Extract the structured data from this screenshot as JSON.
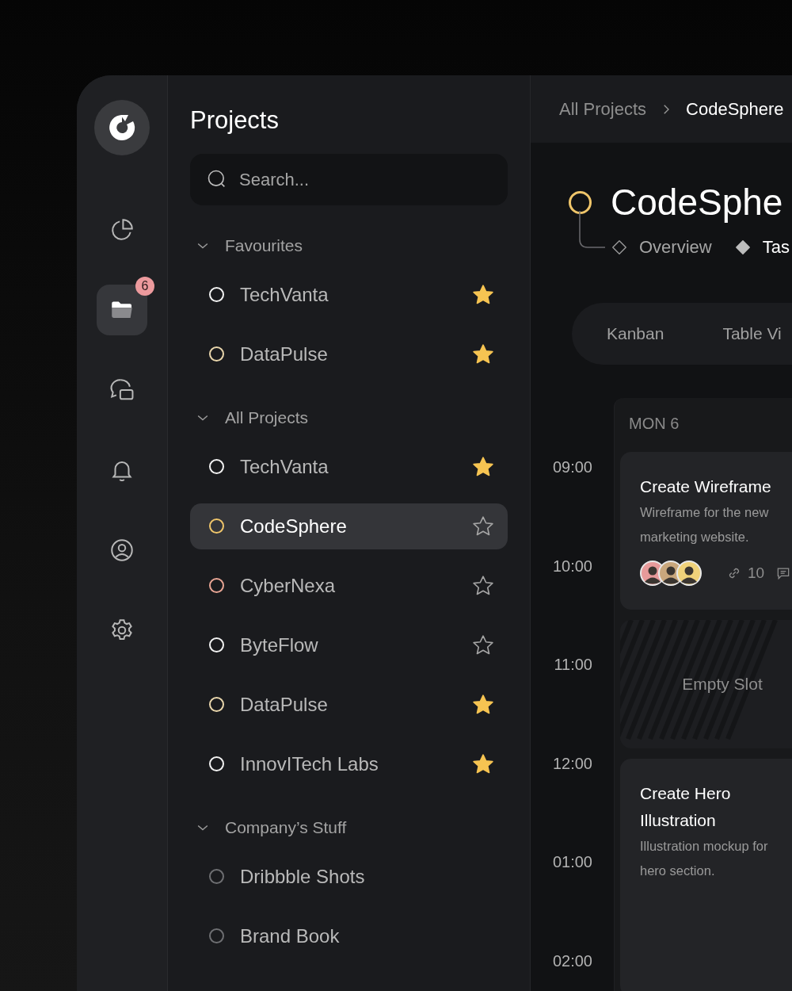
{
  "rail": {
    "items": [
      {
        "kind": "chart",
        "selected": false
      },
      {
        "kind": "folder",
        "selected": true,
        "badge": "6"
      },
      {
        "kind": "chat",
        "selected": false
      },
      {
        "kind": "bell",
        "selected": false
      },
      {
        "kind": "profile",
        "selected": false
      },
      {
        "kind": "settings",
        "selected": false
      }
    ]
  },
  "projects_panel": {
    "title": "Projects",
    "search": {
      "placeholder": "Search..."
    },
    "groups": [
      {
        "label": "Favourites",
        "expanded": true,
        "items": [
          {
            "name": "TechVanta",
            "color": "#f2f2f2",
            "starred": true,
            "selected": false
          },
          {
            "name": "DataPulse",
            "color": "#e9d6ac",
            "starred": true,
            "selected": false
          }
        ]
      },
      {
        "label": "All Projects",
        "expanded": true,
        "items": [
          {
            "name": "TechVanta",
            "color": "#f2f2f2",
            "starred": true,
            "selected": false
          },
          {
            "name": "CodeSphere",
            "color": "#efc56a",
            "starred": false,
            "selected": true
          },
          {
            "name": "CyberNexa",
            "color": "#e7a594",
            "starred": false,
            "selected": false
          },
          {
            "name": "ByteFlow",
            "color": "#f2f2f2",
            "starred": false,
            "selected": false
          },
          {
            "name": "DataPulse",
            "color": "#e9d6ac",
            "starred": true,
            "selected": false
          },
          {
            "name": "InnovITech Labs",
            "color": "#f2f2f2",
            "starred": true,
            "selected": false
          }
        ]
      },
      {
        "label": "Company’s Stuff",
        "expanded": true,
        "items": [
          {
            "name": "Dribbble Shots",
            "color": "#6e6f72",
            "selected": false
          },
          {
            "name": "Brand Book",
            "color": "#6e6f72",
            "selected": false
          }
        ]
      }
    ]
  },
  "breadcrumb": [
    {
      "label": "All Projects",
      "current": false
    },
    {
      "label": "CodeSphere",
      "current": true
    }
  ],
  "project": {
    "title": "CodeSphe",
    "color": "#efc56a",
    "tabs": [
      {
        "label": "Overview",
        "selected": false
      },
      {
        "label": "Tas",
        "selected": true
      }
    ],
    "views": [
      {
        "label": "Kanban"
      },
      {
        "label": "Table Vi"
      }
    ]
  },
  "calendar": {
    "day": "MON 6",
    "times": [
      "09:00",
      "10:00",
      "11:00",
      "12:00",
      "01:00",
      "02:00"
    ],
    "slots": [
      {
        "kind": "task",
        "title": "Create Wireframe",
        "description": "Wireframe for the new marketing website.",
        "avatars": [
          {
            "color": "#e79a9a"
          },
          {
            "color": "#c9a77c"
          },
          {
            "color": "#f0d27a"
          }
        ],
        "links": "10"
      },
      {
        "kind": "empty",
        "label": "Empty Slot"
      },
      {
        "kind": "task",
        "title": "Create Hero Illustration",
        "description": "Illustration mockup for hero section."
      }
    ]
  }
}
